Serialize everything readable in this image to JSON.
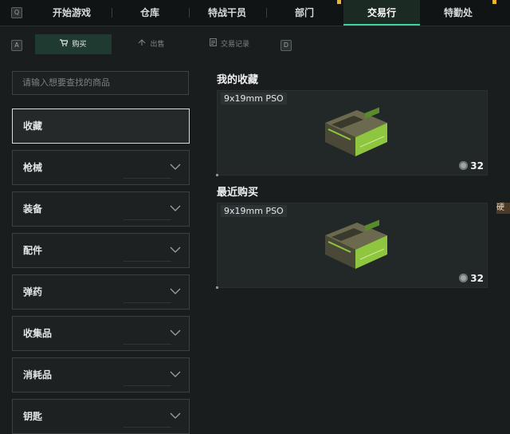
{
  "topnav": {
    "left_key": "Q",
    "right_key": "",
    "tabs": [
      {
        "label": "开始游戏"
      },
      {
        "label": "仓库"
      },
      {
        "label": "特战干员"
      },
      {
        "label": "部门"
      },
      {
        "label": "交易行"
      },
      {
        "label": "特勤处"
      }
    ],
    "active_tab": "交易行",
    "accent": "#3fd49c",
    "badge_color": "#e8b431"
  },
  "subnav": {
    "left_key": "A",
    "right_key": "D",
    "tabs": [
      {
        "label": "购买",
        "icon": "cart-icon"
      },
      {
        "label": "出售",
        "icon": "sell-icon"
      },
      {
        "label": "交易记录",
        "icon": "record-icon"
      }
    ],
    "active_tab": "购买"
  },
  "search": {
    "placeholder": "请输入想要查找的商品"
  },
  "categories": [
    {
      "label": "收藏",
      "selected": true
    },
    {
      "label": "枪械"
    },
    {
      "label": "装备"
    },
    {
      "label": "配件"
    },
    {
      "label": "弹药"
    },
    {
      "label": "收集品"
    },
    {
      "label": "消耗品"
    },
    {
      "label": "钥匙"
    }
  ],
  "favorites": {
    "title": "我的收藏",
    "item": {
      "name": "9x19mm PSO",
      "price": "32",
      "icon": "ammo-box-icon"
    }
  },
  "recent": {
    "title": "最近购买",
    "item": {
      "name": "9x19mm PSO",
      "price": "32",
      "icon": "ammo-box-icon"
    }
  },
  "side_peek_label": "硬"
}
